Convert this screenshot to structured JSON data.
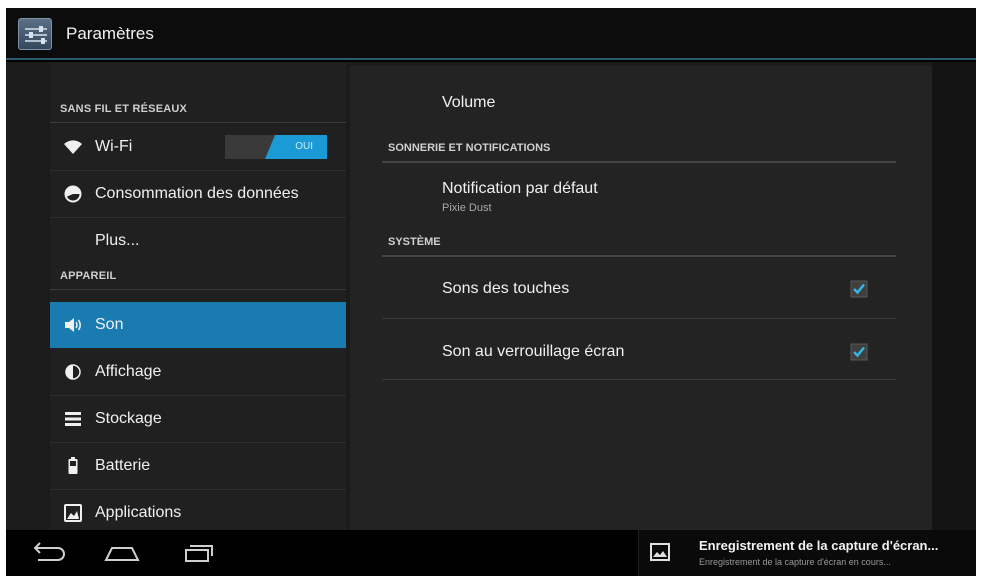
{
  "app": {
    "title": "Paramètres"
  },
  "sidebar": {
    "sections": [
      {
        "header": "SANS FIL ET RÉSEAUX"
      },
      {
        "header": "APPAREIL"
      }
    ],
    "items": [
      {
        "label": "Wi-Fi",
        "icon": "wifi-icon",
        "toggle": "OUI"
      },
      {
        "label": "Consommation des données",
        "icon": "data-usage-icon"
      },
      {
        "label": "Plus..."
      },
      {
        "label": "Son",
        "icon": "speaker-icon",
        "selected": true
      },
      {
        "label": "Affichage",
        "icon": "brightness-icon"
      },
      {
        "label": "Stockage",
        "icon": "storage-icon"
      },
      {
        "label": "Batterie",
        "icon": "battery-icon"
      },
      {
        "label": "Applications",
        "icon": "apps-icon"
      }
    ]
  },
  "content": {
    "volume": "Volume",
    "sections": {
      "sound_notifications": "SONNERIE ET NOTIFICATIONS",
      "system": "SYSTÈME"
    },
    "default_notification": {
      "title": "Notification par défaut",
      "summary": "Pixie Dust"
    },
    "touch_sounds": {
      "title": "Sons des touches",
      "checked": true
    },
    "lock_sound": {
      "title": "Son au verrouillage écran",
      "checked": true
    }
  },
  "navbar": {
    "buttons": [
      "back-icon",
      "home-icon",
      "recent-apps-icon"
    ],
    "notification": {
      "title": "Enregistrement de la capture d'écran...",
      "subtitle": "Enregistrement de la capture d'écran en cours..."
    }
  },
  "colors": {
    "accent": "#1a7bb0",
    "toggle_on": "#1a9bd6",
    "action_bar_line": "#2d5a73"
  }
}
